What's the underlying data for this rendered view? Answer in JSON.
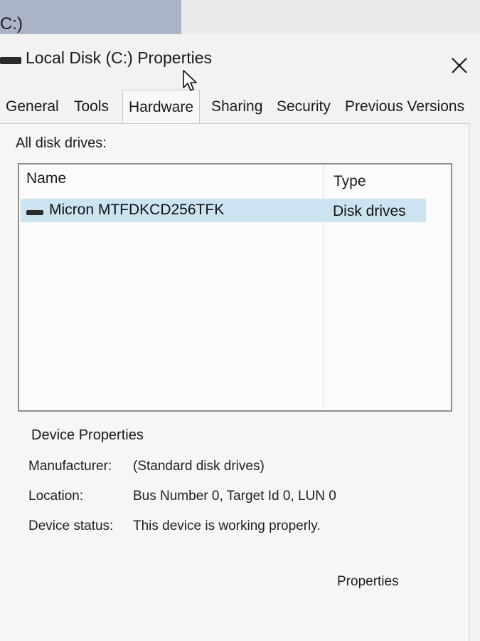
{
  "background": {
    "partial_title": "C:)"
  },
  "window": {
    "title": "Local Disk (C:) Properties",
    "close_symbol": "✕"
  },
  "tabs": [
    {
      "label": "General",
      "active": false
    },
    {
      "label": "Tools",
      "active": false
    },
    {
      "label": "Hardware",
      "active": true
    },
    {
      "label": "Sharing",
      "active": false
    },
    {
      "label": "Security",
      "active": false
    },
    {
      "label": "Previous Versions",
      "active": false
    }
  ],
  "hardware": {
    "list_label": "All disk drives:",
    "columns": [
      "Name",
      "Type"
    ],
    "rows": [
      {
        "name": "Micron MTFDKCD256TFK",
        "type": "Disk drives",
        "selected": true
      }
    ],
    "device_properties": {
      "title": "Device Properties",
      "fields": [
        {
          "label": "Manufacturer:",
          "value": "(Standard disk drives)"
        },
        {
          "label": "Location:",
          "value": "Bus Number 0, Target Id 0, LUN 0"
        },
        {
          "label": "Device status:",
          "value": "This device is working properly."
        }
      ]
    },
    "properties_button": "Properties"
  },
  "colors": {
    "selection": "#cce4f2",
    "background_strip": "#aab4c6"
  }
}
